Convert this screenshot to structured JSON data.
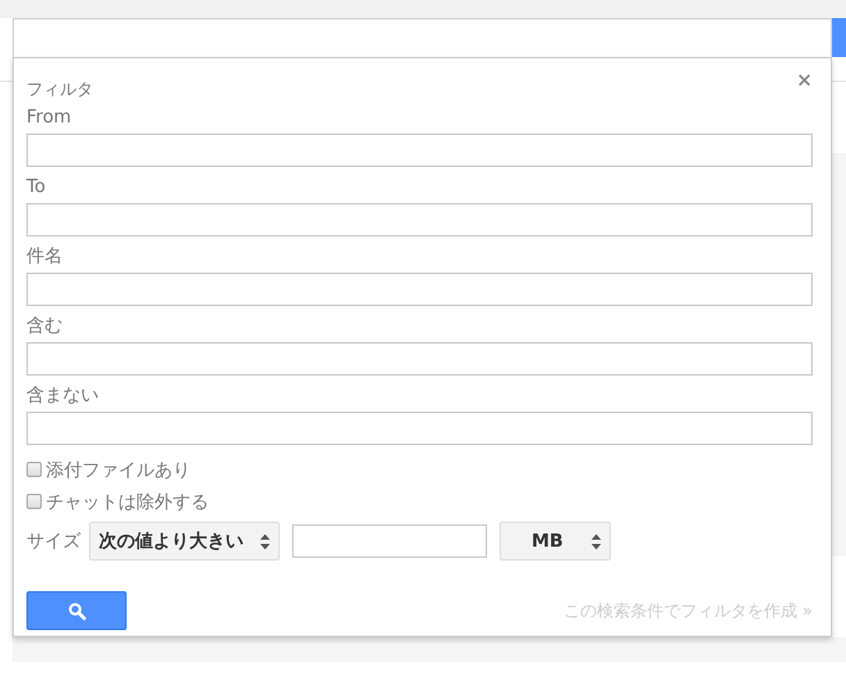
{
  "filter_panel": {
    "title": "フィルタ",
    "close": "×",
    "fields": [
      {
        "label": "From"
      },
      {
        "label": "To"
      },
      {
        "label": "件名"
      },
      {
        "label": "含む"
      },
      {
        "label": "含まない"
      }
    ],
    "checkboxes": [
      {
        "label": "添付ファイルあり",
        "checked": false
      },
      {
        "label": "チャットは除外する",
        "checked": false
      }
    ],
    "size": {
      "label": "サイズ",
      "operator": "次の値より大きい",
      "unit": "MB"
    },
    "create_filter_link": "この検索条件でフィルタを作成 »"
  }
}
